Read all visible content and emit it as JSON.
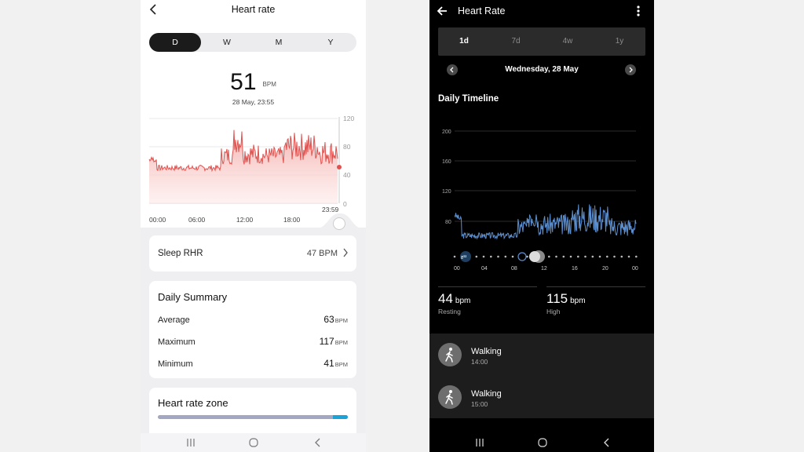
{
  "left": {
    "header": {
      "title": "Heart rate"
    },
    "period_tabs": [
      "D",
      "W",
      "M",
      "Y"
    ],
    "active_tab": "D",
    "current": {
      "value": "51",
      "unit": "BPM",
      "timestamp": "28 May, 23:55"
    },
    "chart": {
      "x_labels": [
        "00:00",
        "06:00",
        "12:00",
        "18:00"
      ],
      "current_time_label": "23:59",
      "y_labels": [
        "120",
        "80",
        "40",
        "0"
      ]
    },
    "sleep_rhr": {
      "label": "Sleep RHR",
      "value": "47 BPM"
    },
    "daily_summary": {
      "title": "Daily Summary",
      "rows": [
        {
          "label": "Average",
          "value": "63",
          "unit": "BPM"
        },
        {
          "label": "Maximum",
          "value": "117",
          "unit": "BPM"
        },
        {
          "label": "Minimum",
          "value": "41",
          "unit": "BPM"
        }
      ]
    },
    "zone": {
      "title": "Heart rate zone",
      "blue_fraction": 0.08
    },
    "colors": {
      "line": "#e0524f",
      "fill": "#f6c9c6",
      "accent_dark": "#1b1b1b"
    }
  },
  "right": {
    "header": {
      "title": "Heart Rate"
    },
    "period_tabs": [
      "1d",
      "7d",
      "4w",
      "1y"
    ],
    "active_tab": "1d",
    "date": "Wednesday, 28 May",
    "section_title": "Daily Timeline",
    "chart": {
      "y_labels": [
        "200",
        "160",
        "120",
        "80"
      ],
      "x_labels": [
        "00",
        "04",
        "08",
        "12",
        "16",
        "20",
        "00"
      ]
    },
    "stats": [
      {
        "value": "44",
        "unit": "bpm",
        "label": "Resting"
      },
      {
        "value": "115",
        "unit": "bpm",
        "label": "High"
      }
    ],
    "activities": [
      {
        "name": "Walking",
        "time": "14:00",
        "icon": "walking-icon"
      },
      {
        "name": "Walking",
        "time": "15:00",
        "icon": "walking-icon"
      }
    ],
    "colors": {
      "line": "#5b8fd0",
      "background": "#000000"
    }
  }
}
